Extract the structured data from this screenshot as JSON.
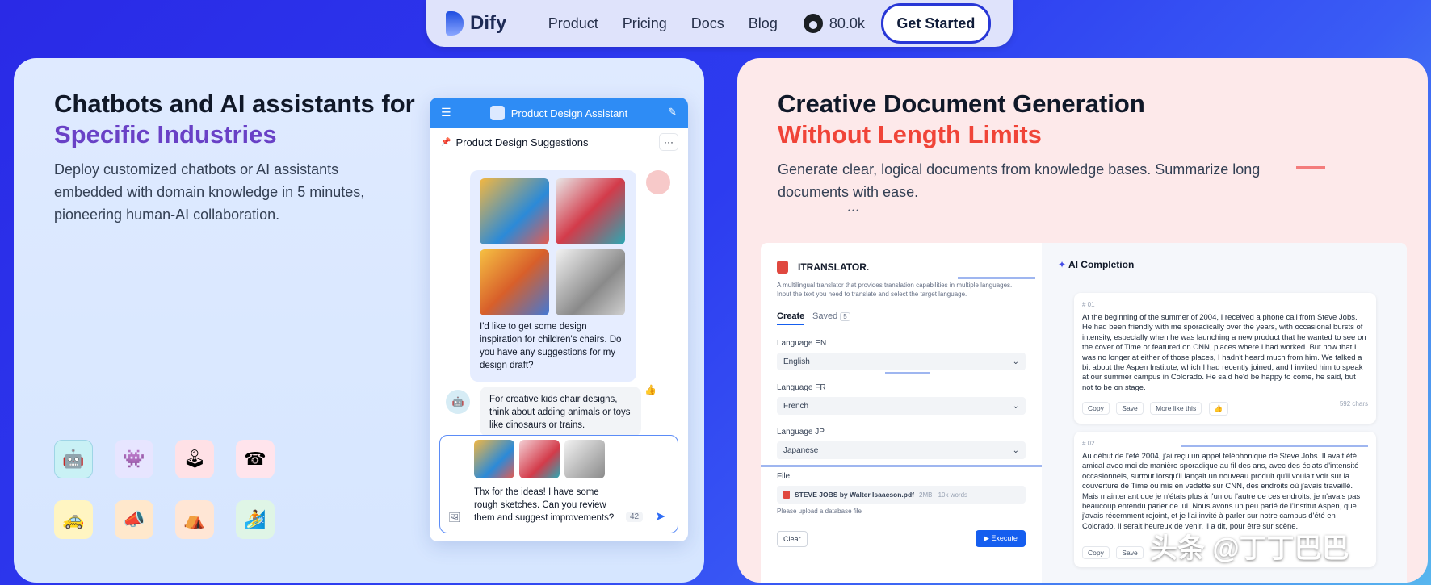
{
  "nav": {
    "logo": "Dify",
    "logo_underscore": "_",
    "links": [
      "Product",
      "Pricing",
      "Docs",
      "Blog"
    ],
    "github_stars": "80.0k",
    "cta": "Get Started"
  },
  "left_card": {
    "title_line1": "Chatbots and AI assistants for",
    "title_line2": "Specific Industries",
    "description": "Deploy customized chatbots or AI assistants embedded with domain knowledge in 5 minutes, pioneering human-AI collaboration.",
    "app_icons": [
      "robot-icon",
      "alien-icon",
      "joystick-icon",
      "telephone-icon",
      "taxi-icon",
      "megaphone-icon",
      "tent-icon",
      "surfer-icon"
    ],
    "chat": {
      "header_title": "Product Design Assistant",
      "sub_title": "Product Design Suggestions",
      "user_message": "I'd like to get some design inspiration for children's chairs. Do you have any suggestions for my design draft?",
      "bot_message": "For creative kids chair designs, think about adding animals or toys like dinosaurs or trains.",
      "input_text": "Thx for the ideas! I have some rough sketches. Can you review them and suggest improvements?",
      "char_count": "42"
    }
  },
  "right_card": {
    "title_line1": "Creative Document Generation",
    "title_line2": "Without Length Limits",
    "description": "Generate clear, logical documents from knowledge bases. Summarize long documents with ease.",
    "ellipsis": "•••",
    "app": {
      "name": "ITRANSLATOR.",
      "desc": "A multilingual translator that provides translation capabilities in multiple languages. Input the text you need to translate and select the target language.",
      "tab_create": "Create",
      "tab_saved": "Saved",
      "saved_count": "5",
      "fields": [
        {
          "label": "Language EN",
          "value": "English"
        },
        {
          "label": "Language FR",
          "value": "French"
        },
        {
          "label": "Language JP",
          "value": "Japanese"
        }
      ],
      "file_label": "File",
      "file_name": "STEVE JOBS by Walter Isaacson.pdf",
      "file_meta": "2MB · 10k words",
      "file_hint": "Please upload a database file",
      "clear_btn": "Clear",
      "execute_btn": "Execute"
    },
    "completion": {
      "title": "AI Completion",
      "cards": [
        {
          "index": "# 01",
          "text": "At the beginning of the summer of 2004, I received a phone call from Steve Jobs. He had been friendly with me sporadically over the years, with occasional bursts of intensity, especially when he was launching a new product that he wanted to see on the cover of Time or featured on CNN, places where I had worked. But now that I was no longer at either of those places, I hadn't heard much from him. We talked a bit about the Aspen Institute, which I had recently joined, and I invited him to speak at our summer campus in Colorado. He said he'd be happy to come, he said, but not to be on stage.",
          "copy": "Copy",
          "save": "Save",
          "more": "More like this",
          "chars": "592 chars"
        },
        {
          "index": "# 02",
          "text": "Au début de l'été 2004, j'ai reçu un appel téléphonique de Steve Jobs. Il avait été amical avec moi de manière sporadique au fil des ans, avec des éclats d'intensité occasionnels, surtout lorsqu'il lançait un nouveau produit qu'il voulait voir sur la couverture de Time ou mis en vedette sur CNN, des endroits où j'avais travaillé. Mais maintenant que je n'étais plus à l'un ou l'autre de ces endroits, je n'avais pas beaucoup entendu parler de lui. Nous avons un peu parlé de l'Institut Aspen, que j'avais récemment rejoint, et je l'ai invité à parler sur notre campus d'été en Colorado. Il serait heureux de venir, il a dit, pour être sur scène.",
          "copy": "Copy",
          "save": "Save"
        }
      ]
    }
  },
  "watermark": "头条 @丁丁巴巴"
}
